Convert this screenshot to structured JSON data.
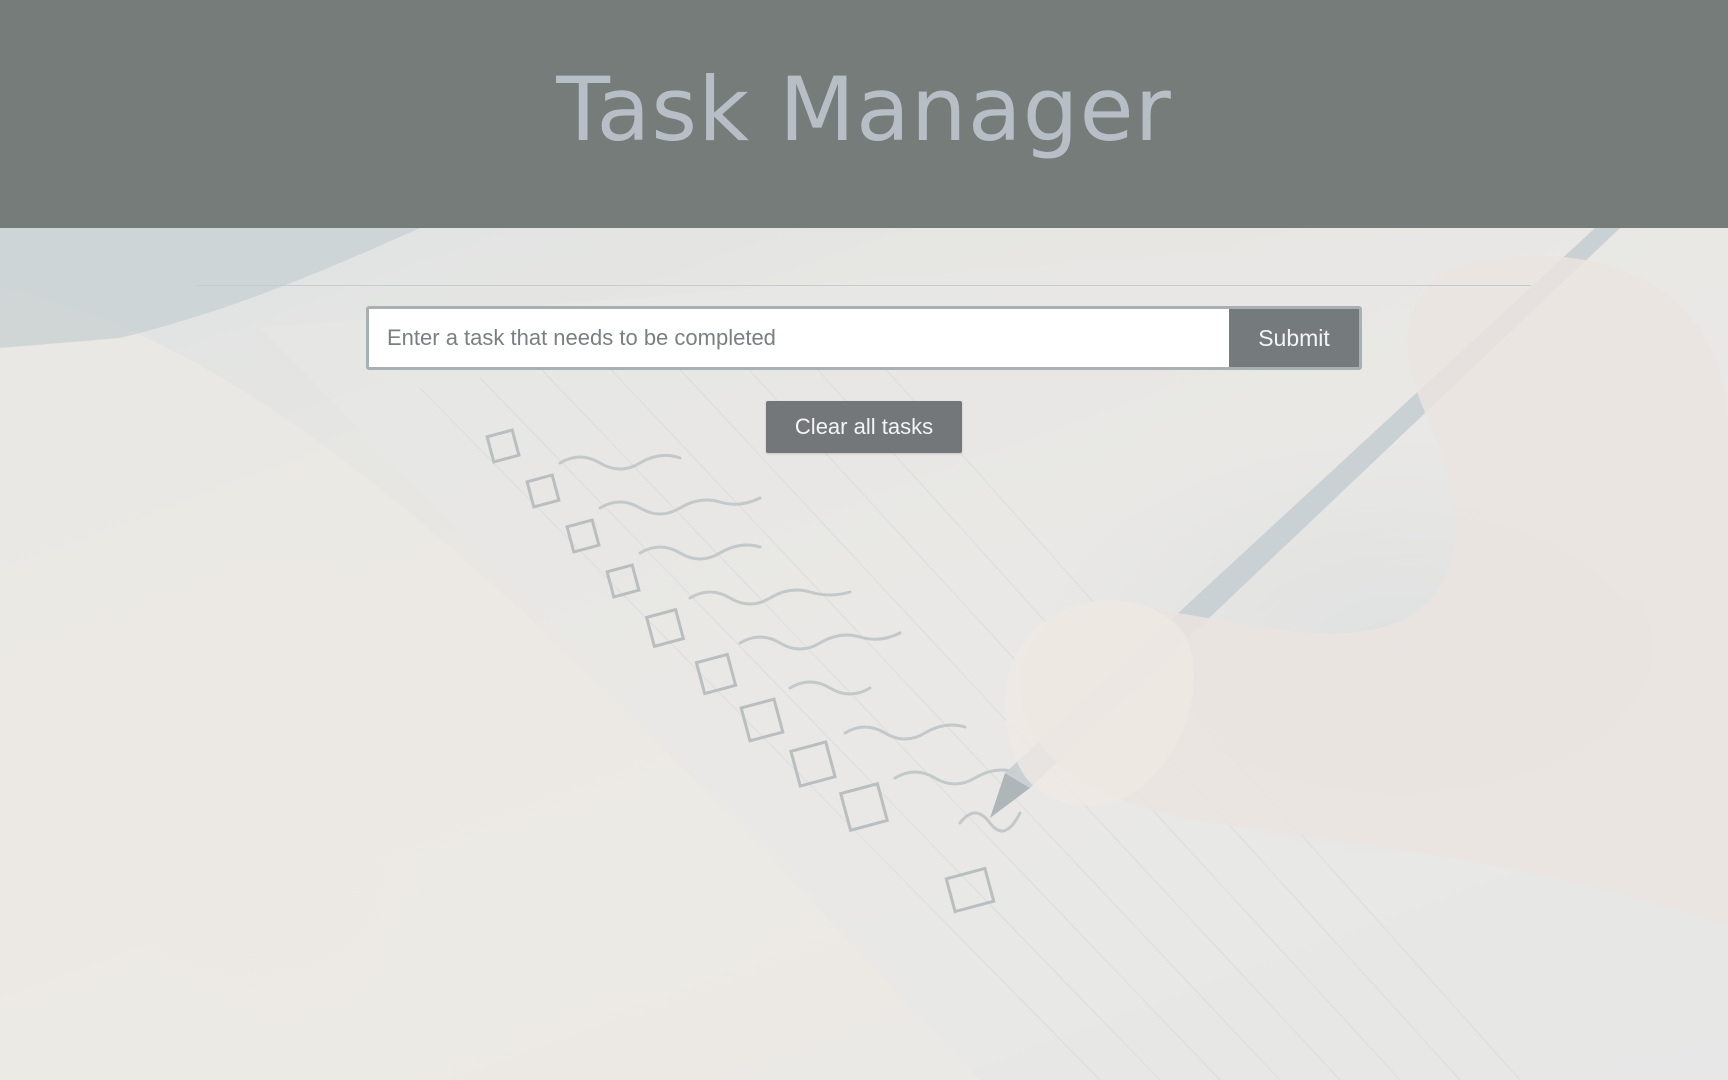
{
  "app": {
    "title": "Task Manager"
  },
  "task_form": {
    "input_value": "",
    "input_placeholder": "Enter a task that needs to be completed",
    "submit_label": "Submit"
  },
  "actions": {
    "clear_label": "Clear all tasks"
  },
  "colors": {
    "header_bg": "#757c79",
    "title_text": "#b8bec6",
    "button_bg": "#757a7d",
    "button_text": "#f3f4f4"
  }
}
